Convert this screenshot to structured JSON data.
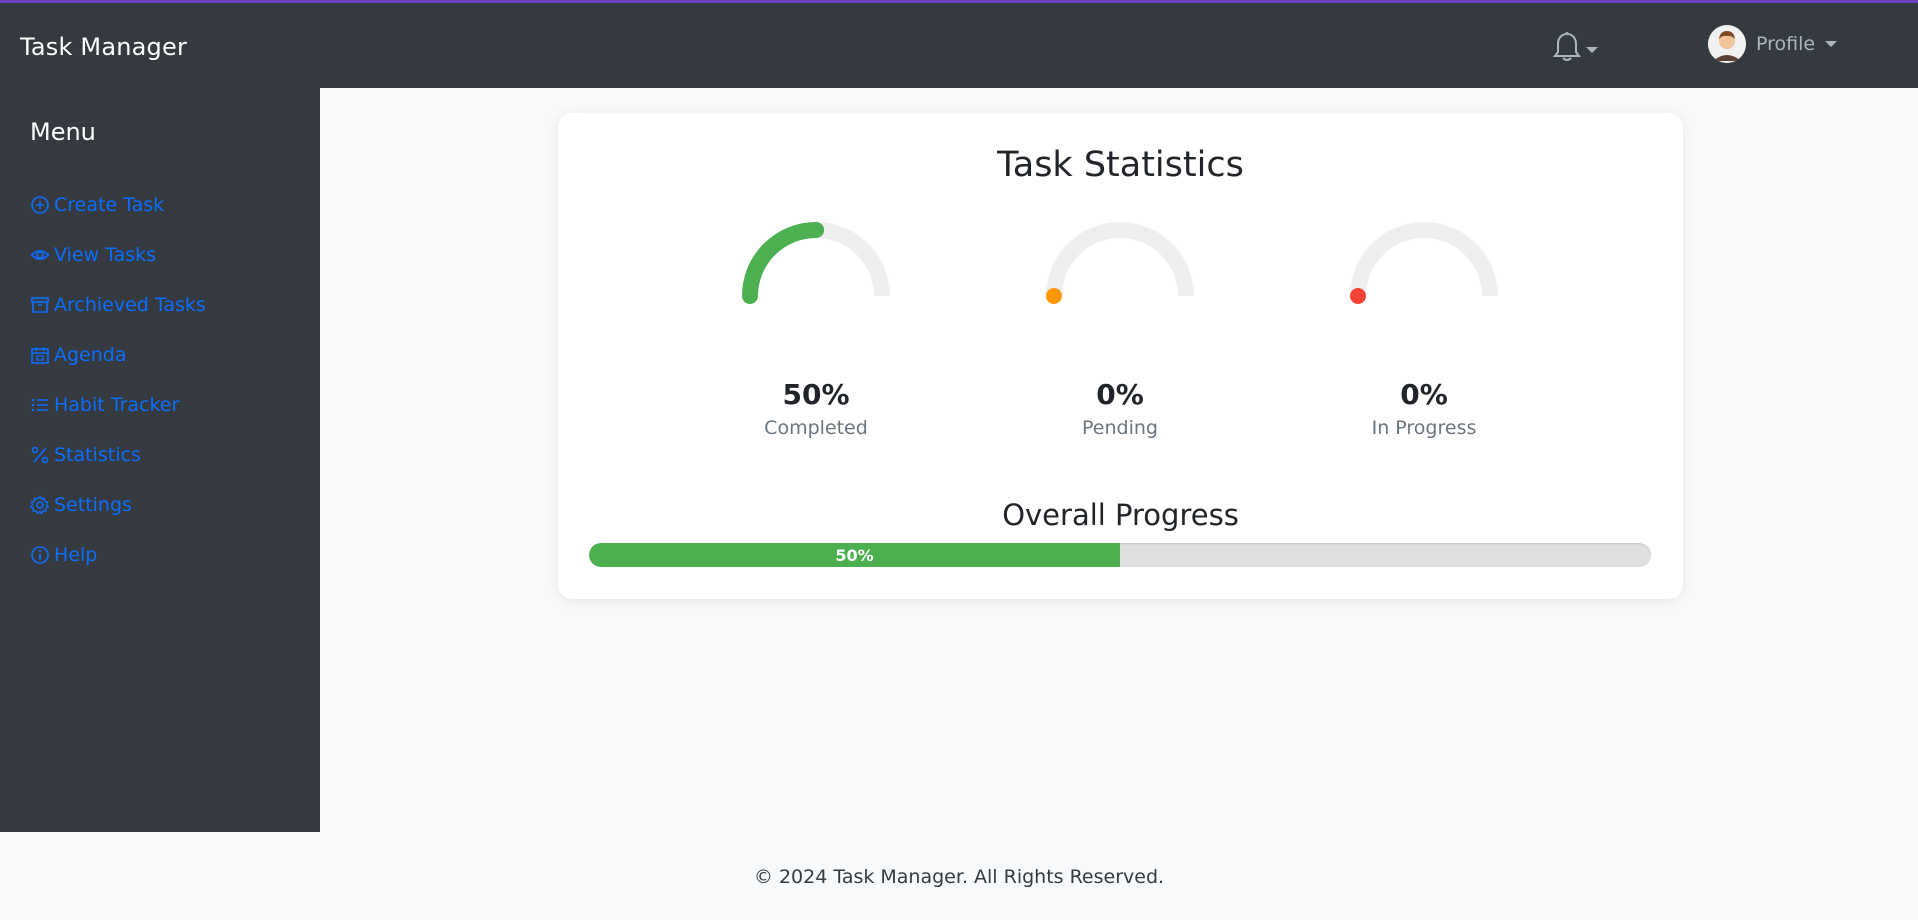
{
  "header": {
    "brand": "Task Manager",
    "notifications_icon": "bell-icon",
    "profile_label": "Profile"
  },
  "sidebar": {
    "title": "Menu",
    "items": [
      {
        "label": "Create Task",
        "icon": "plus-circle-icon"
      },
      {
        "label": "View Tasks",
        "icon": "eye-icon"
      },
      {
        "label": "Archieved Tasks",
        "icon": "archive-icon"
      },
      {
        "label": "Agenda",
        "icon": "calendar-icon"
      },
      {
        "label": "Habit Tracker",
        "icon": "list-icon"
      },
      {
        "label": "Statistics",
        "icon": "percent-icon"
      },
      {
        "label": "Settings",
        "icon": "gear-icon"
      },
      {
        "label": "Help",
        "icon": "info-circle-icon"
      }
    ]
  },
  "stats": {
    "title": "Task Statistics",
    "gauges": [
      {
        "percent": 50,
        "display": "50%",
        "label": "Completed",
        "color": "#4caf50"
      },
      {
        "percent": 0,
        "display": "0%",
        "label": "Pending",
        "color": "#ff9800"
      },
      {
        "percent": 0,
        "display": "0%",
        "label": "In Progress",
        "color": "#f44336"
      }
    ],
    "overall_title": "Overall Progress",
    "overall_percent": 50,
    "overall_display": "50%"
  },
  "footer": {
    "text": "© 2024 Task Manager. All Rights Reserved."
  },
  "colors": {
    "topbar": "#343a40",
    "accent_border": "#6f42c1",
    "link": "#0d6efd",
    "track": "#eeeeee"
  }
}
